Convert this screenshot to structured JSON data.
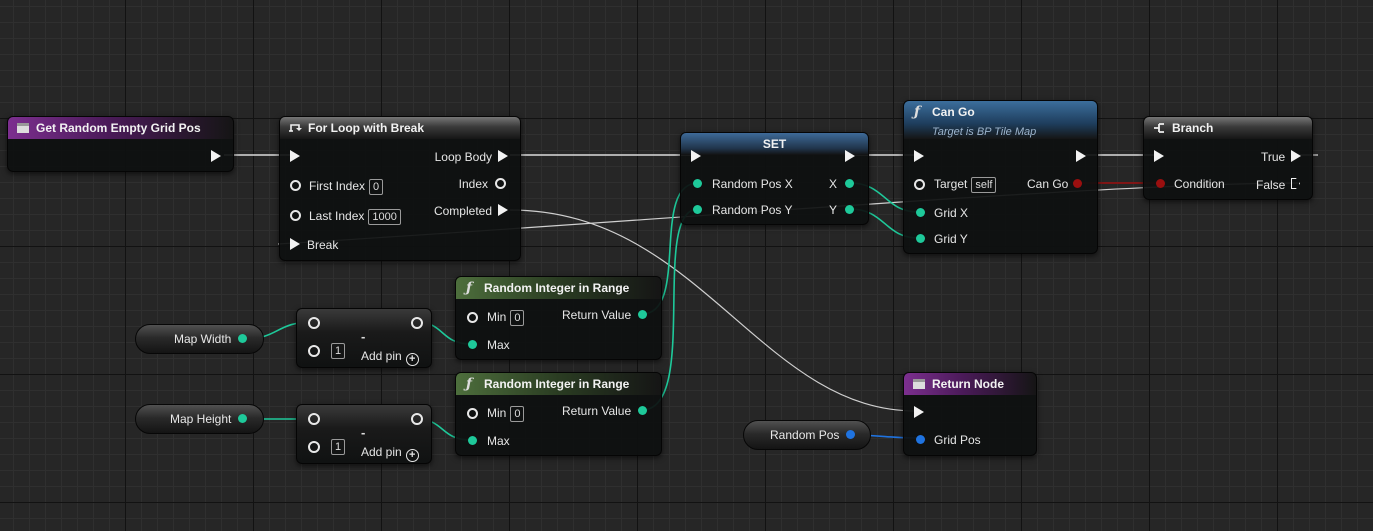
{
  "nodes": {
    "event": {
      "title": "Get Random Empty Grid Pos"
    },
    "forloop": {
      "title": "For Loop with Break",
      "first_index_label": "First Index",
      "first_index_value": "0",
      "last_index_label": "Last Index",
      "last_index_value": "1000",
      "break_label": "Break",
      "loop_body_label": "Loop Body",
      "index_label": "Index",
      "completed_label": "Completed"
    },
    "set": {
      "title": "SET",
      "random_pos_x_label": "Random Pos X",
      "random_pos_y_label": "Random Pos Y",
      "x_label": "X",
      "y_label": "Y"
    },
    "cango": {
      "title": "Can Go",
      "subtitle": "Target is BP Tile Map",
      "target_label": "Target",
      "target_value": "self",
      "grid_x_label": "Grid X",
      "grid_y_label": "Grid Y",
      "can_go_label": "Can Go"
    },
    "branch": {
      "title": "Branch",
      "condition_label": "Condition",
      "true_label": "True",
      "false_label": "False"
    },
    "random1": {
      "title": "Random Integer in Range",
      "min_label": "Min",
      "min_value": "0",
      "max_label": "Max",
      "return_label": "Return Value"
    },
    "random2": {
      "title": "Random Integer in Range",
      "min_label": "Min",
      "min_value": "0",
      "max_label": "Max",
      "return_label": "Return Value"
    },
    "subtract1": {
      "op": "-",
      "value": "1",
      "add_pin_label": "Add pin"
    },
    "subtract2": {
      "op": "-",
      "value": "1",
      "add_pin_label": "Add pin"
    },
    "return_node": {
      "title": "Return Node",
      "grid_pos_label": "Grid Pos"
    },
    "map_width": {
      "label": "Map Width"
    },
    "map_height": {
      "label": "Map Height"
    },
    "random_pos": {
      "label": "Random Pos"
    }
  },
  "colors": {
    "integer_pin": "#1ec99a",
    "struct_pin": "#1f73e0",
    "bool_pin": "#9a0f0f",
    "exec_wire": "#e0e0e0"
  }
}
